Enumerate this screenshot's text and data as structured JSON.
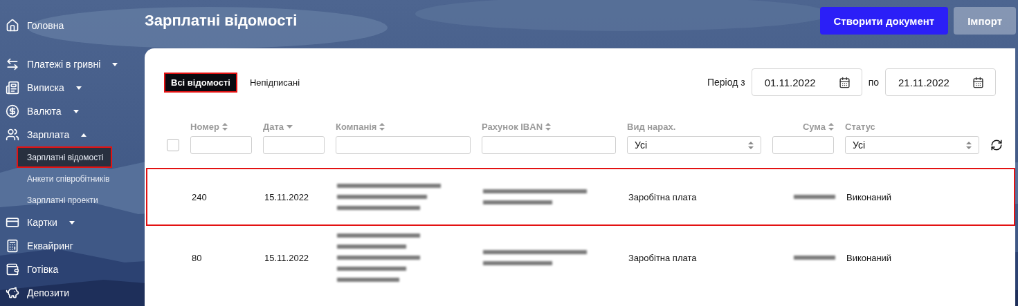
{
  "sidebar": {
    "items": [
      {
        "label": "Головна",
        "kind": "link"
      },
      {
        "label": "Платежі в гривні",
        "kind": "group",
        "expanded": false
      },
      {
        "label": "Виписка",
        "kind": "group",
        "expanded": false
      },
      {
        "label": "Валюта",
        "kind": "group",
        "expanded": false
      },
      {
        "label": "Зарплата",
        "kind": "group",
        "expanded": true,
        "children": [
          {
            "label": "Зарплатні відомості",
            "selected": true
          },
          {
            "label": "Анкети співробітників",
            "selected": false
          },
          {
            "label": "Зарплатні проекти",
            "selected": false
          }
        ]
      },
      {
        "label": "Картки",
        "kind": "group",
        "expanded": false
      },
      {
        "label": "Еквайринг",
        "kind": "link"
      },
      {
        "label": "Готівка",
        "kind": "link"
      },
      {
        "label": "Депозити",
        "kind": "link"
      }
    ]
  },
  "page_title": "Зарплатні відомості",
  "buttons": [
    {
      "label": "Створити документ",
      "kind": "primary"
    },
    {
      "label": "Імпорт",
      "kind": "secondary"
    }
  ],
  "tabs": [
    {
      "label": "Всі відомості",
      "selected": true
    },
    {
      "label": "Непідписані",
      "selected": false
    }
  ],
  "period": {
    "label_from": "Період з",
    "from": "01.11.2022",
    "label_to": "по",
    "to": "21.11.2022"
  },
  "table": {
    "columns": [
      {
        "label": "Номер",
        "sortable": true,
        "sorted": false,
        "kind": "text"
      },
      {
        "label": "Дата",
        "sortable": true,
        "sorted": true,
        "kind": "text"
      },
      {
        "label": "Компанія",
        "sortable": true,
        "sorted": false,
        "kind": "text"
      },
      {
        "label": "Рахунок IBAN",
        "sortable": true,
        "sorted": false,
        "kind": "text"
      },
      {
        "label": "Вид нарах.",
        "sortable": false,
        "value": "Усі",
        "kind": "select"
      },
      {
        "label": "Сума",
        "sortable": true,
        "sorted": false,
        "kind": "amount"
      },
      {
        "label": "Статус",
        "sortable": false,
        "value": "Усі",
        "kind": "select"
      }
    ],
    "select_all": {
      "checked": false
    },
    "rows": [
      {
        "number": "240",
        "date": "15.11.2022",
        "accrual_type": "Заробітна плата",
        "status": "Виконаний",
        "highlighted": true
      },
      {
        "number": "80",
        "date": "15.11.2022",
        "accrual_type": "Заробітна плата",
        "status": "Виконаний",
        "highlighted": false
      }
    ]
  }
}
